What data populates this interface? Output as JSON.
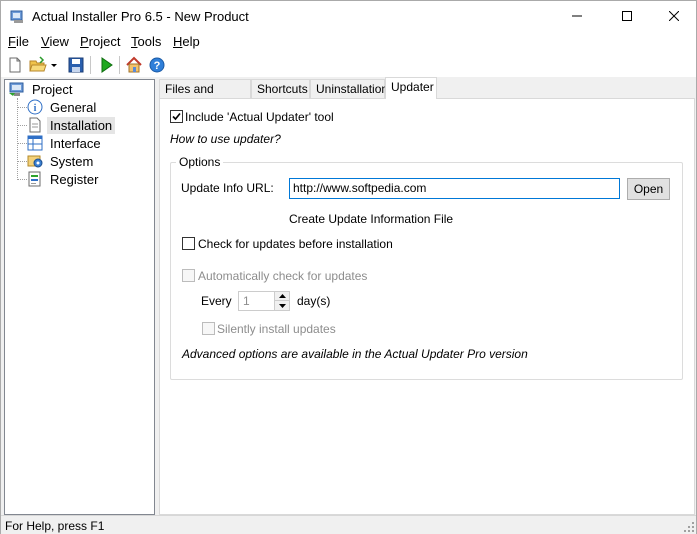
{
  "window": {
    "title": "Actual Installer Pro 6.5 - New Product"
  },
  "menu": {
    "items": [
      "File",
      "View",
      "Project",
      "Tools",
      "Help"
    ]
  },
  "toolbar": {
    "icons": [
      "new-file-icon",
      "open-folder-icon",
      "dropdown-arrow-icon",
      "save-icon",
      "build-run-icon",
      "home-icon",
      "help-icon"
    ]
  },
  "tree": {
    "root": "Project",
    "items": [
      {
        "label": "General",
        "icon": "info-icon"
      },
      {
        "label": "Installation",
        "icon": "document-icon",
        "selected": true
      },
      {
        "label": "Interface",
        "icon": "grid-icon"
      },
      {
        "label": "System",
        "icon": "system-icon"
      },
      {
        "label": "Register",
        "icon": "register-icon"
      }
    ]
  },
  "tabs": [
    {
      "label": "Files and Folders"
    },
    {
      "label": "Shortcuts"
    },
    {
      "label": "Uninstallation"
    },
    {
      "label": "Updater",
      "active": true
    }
  ],
  "updater": {
    "include_label": "Include 'Actual Updater' tool",
    "include_checked": true,
    "how_to_link": "How to use updater?",
    "options_title": "Options",
    "url_label": "Update Info URL:",
    "url_value": "http://www.softpedia.com",
    "open_button": "Open",
    "create_file_label": "Create Update Information File",
    "check_before_install_label": "Check for updates before installation",
    "check_before_install_checked": false,
    "auto_check_label": "Automatically check for updates",
    "every_label": "Every",
    "every_value": "1",
    "days_label": "day(s)",
    "silent_label": "Silently install updates",
    "advanced_note": "Advanced options are available in the Actual Updater Pro version"
  },
  "status": {
    "text": "For Help, press F1"
  },
  "colors": {
    "accent": "#0078d7",
    "selection": "#e5e5e5",
    "disabled_text": "#8d8d8d"
  }
}
